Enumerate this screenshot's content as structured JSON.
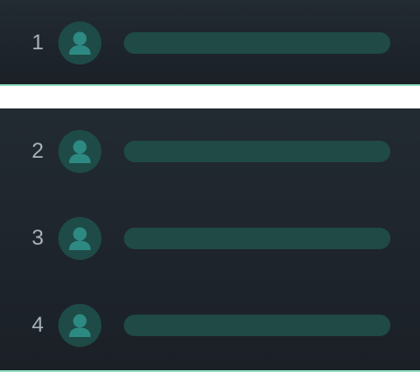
{
  "leaderboard": {
    "top_entry": {
      "rank": "1",
      "avatar_icon": "user-icon"
    },
    "entries": [
      {
        "rank": "2",
        "avatar_icon": "user-icon"
      },
      {
        "rank": "3",
        "avatar_icon": "user-icon"
      },
      {
        "rank": "4",
        "avatar_icon": "user-icon"
      }
    ]
  },
  "colors": {
    "panel_bg": "#1b2027",
    "accent_line": "#8fe0c3",
    "avatar_bg": "#1e4b47",
    "avatar_icon": "#2d8a82",
    "placeholder_bar": "#1f4a46",
    "rank_text": "#a7b2bc"
  }
}
